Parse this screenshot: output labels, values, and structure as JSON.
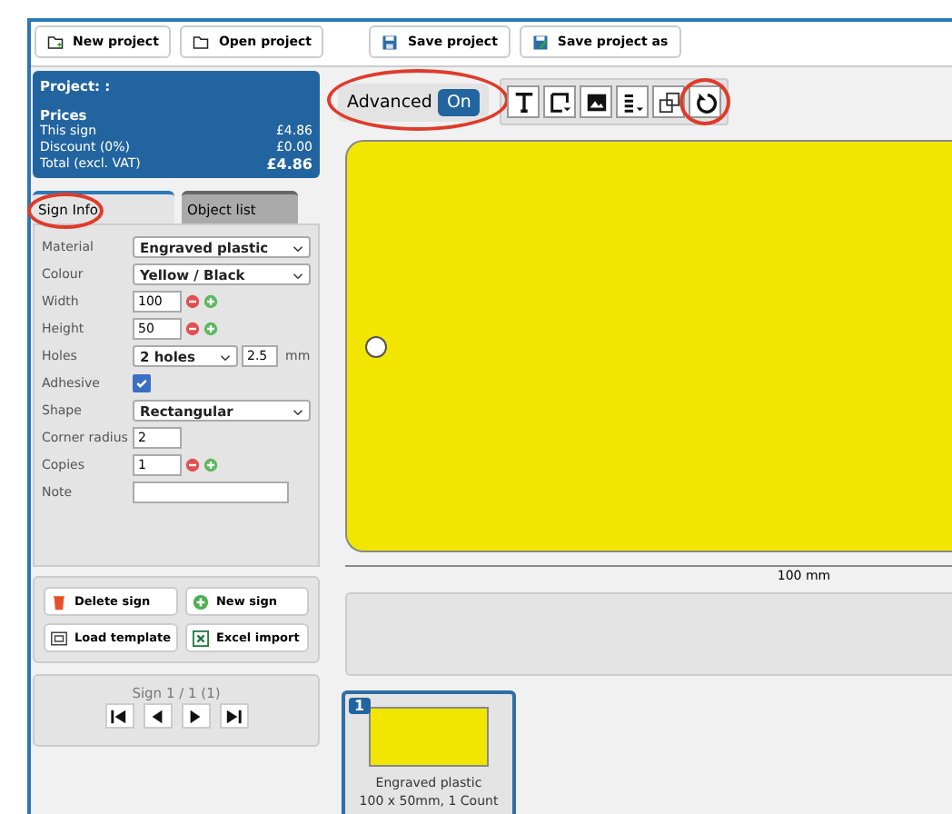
{
  "toolbar": [
    {
      "label": "New project"
    },
    {
      "label": "Open project"
    },
    {
      "label": "Save project"
    },
    {
      "label": "Save project as"
    }
  ],
  "project": {
    "title": "Project: :",
    "prices_heading": "Prices",
    "rows": [
      {
        "label": "This sign",
        "value": "£4.86",
        "bold": false
      },
      {
        "label": "Discount (0%)",
        "value": "£0.00",
        "bold": false
      },
      {
        "label": "Total (excl. VAT)",
        "value": "£4.86",
        "bold": true
      }
    ]
  },
  "tabs": [
    {
      "label": "Sign Info",
      "selected": true,
      "highlighted": true
    },
    {
      "label": "Object list",
      "selected": false,
      "highlighted": false
    }
  ],
  "fields": [
    {
      "kind": "select",
      "label": "Material",
      "value": "Engraved plastic"
    },
    {
      "kind": "select",
      "label": "Colour",
      "value": "Yellow / Black"
    },
    {
      "kind": "stepper",
      "label": "Width",
      "value": "100"
    },
    {
      "kind": "stepper",
      "label": "Height",
      "value": "50"
    },
    {
      "kind": "holes",
      "label": "Holes",
      "value": "2 holes",
      "size": "2.5",
      "unit": "mm"
    },
    {
      "kind": "checkbox",
      "label": "Adhesive",
      "checked": true
    },
    {
      "kind": "select",
      "label": "Shape",
      "value": "Rectangular"
    },
    {
      "kind": "text",
      "label": "Corner radius",
      "value": "2"
    },
    {
      "kind": "stepper",
      "label": "Copies",
      "value": "1"
    },
    {
      "kind": "note",
      "label": "Note"
    }
  ],
  "actions": [
    {
      "label": "Delete sign"
    },
    {
      "label": "New sign"
    },
    {
      "label": "Load template"
    },
    {
      "label": "Excel import"
    }
  ],
  "navigator": {
    "label": "Sign 1 / 1 (1)"
  },
  "advanced": {
    "label": "Advanced",
    "value": "On",
    "on": true,
    "highlighted": true
  },
  "tools": [
    {
      "highlighted": false
    },
    {
      "highlighted": false
    },
    {
      "highlighted": false
    },
    {
      "highlighted": false
    },
    {
      "highlighted": false
    },
    {
      "highlighted": true
    }
  ],
  "canvas": {
    "ruler_label": "100 mm"
  },
  "thumbnails": [
    {
      "number": "1",
      "selected": true,
      "line1": "Engraved plastic",
      "line2": "100 x 50mm, 1 Count"
    }
  ]
}
